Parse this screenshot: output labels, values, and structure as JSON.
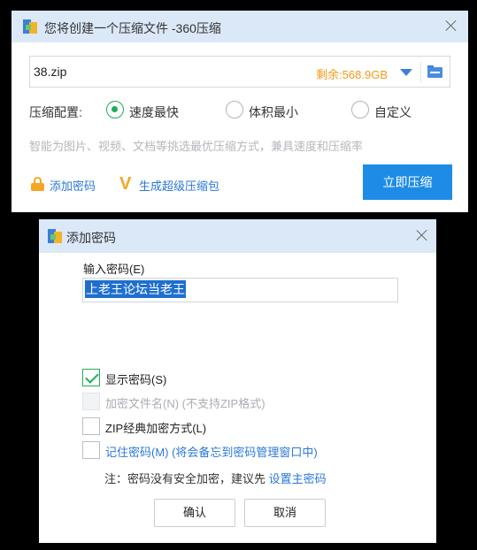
{
  "main_window": {
    "title": "您将创建一个压缩文件 -360压缩",
    "filename": "38.zip",
    "free_space": "剩余:568.9GB",
    "config_label": "压缩配置:",
    "options": [
      {
        "label": "速度最快",
        "selected": true
      },
      {
        "label": "体积最小",
        "selected": false
      },
      {
        "label": "自定义",
        "selected": false
      }
    ],
    "hint": "智能为图片、视频、文档等挑选最优压缩方式，兼具速度和压缩率",
    "add_password": "添加密码",
    "super_package": "生成超级压缩包",
    "compress_button": "立即压缩"
  },
  "dialog": {
    "title": "添加密码",
    "input_label": "输入密码(E)",
    "password_value": "上老王论坛当老王",
    "checkboxes": [
      {
        "label": "显示密码(S)",
        "checked": true,
        "enabled": true
      },
      {
        "label": "加密文件名(N) (不支持ZIP格式)",
        "checked": false,
        "enabled": false
      },
      {
        "label": "ZIP经典加密方式(L)",
        "checked": false,
        "enabled": true
      },
      {
        "label": "记住密码(M) (将会备忘到密码管理窗口中)",
        "checked": false,
        "enabled": true
      }
    ],
    "note_prefix": "注：密码没有安全加密，建议先 ",
    "note_link": "设置主密码",
    "ok_button": "确认",
    "cancel_button": "取消"
  },
  "colors": {
    "accent": "#1e8ce6",
    "success": "#1fae58",
    "warning": "#f39a18",
    "link": "#2a78d6",
    "titlebar": "#dbe8f8"
  }
}
